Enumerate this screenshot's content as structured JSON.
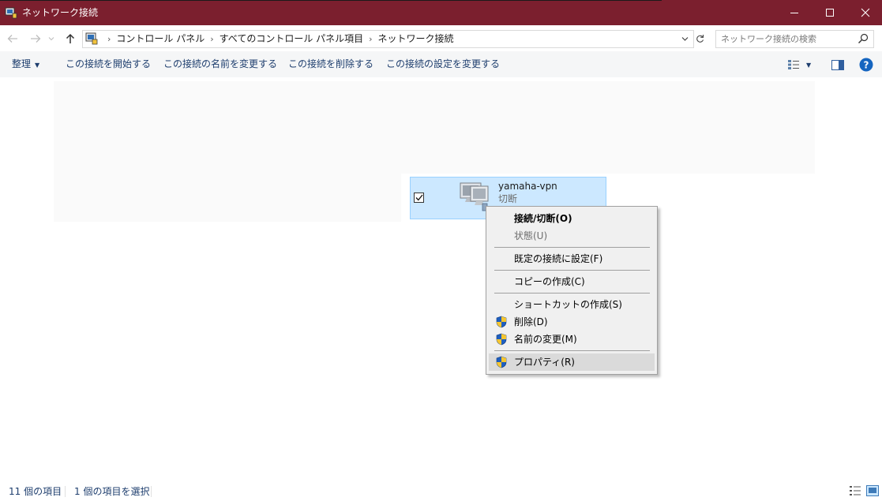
{
  "window": {
    "title": "ネットワーク接続",
    "accent_color": "#7b1f2e"
  },
  "address_bar": {
    "breadcrumbs": [
      "コントロール パネル",
      "すべてのコントロール パネル項目",
      "ネットワーク接続"
    ],
    "search_placeholder": "ネットワーク接続の検索"
  },
  "command_bar": {
    "organize": "整理",
    "commands": [
      "この接続を開始する",
      "この接続の名前を変更する",
      "この接続を削除する",
      "この接続の設定を変更する"
    ]
  },
  "connection_item": {
    "name": "yamaha-vpn",
    "status": "切断",
    "checked": true
  },
  "context_menu": {
    "items": [
      {
        "label": "接続/切断(O)",
        "bold": true,
        "disabled": false,
        "shield": false
      },
      {
        "label": "状態(U)",
        "bold": false,
        "disabled": true,
        "shield": false
      },
      {
        "label": "既定の接続に設定(F)",
        "bold": false,
        "disabled": false,
        "shield": false
      },
      {
        "label": "コピーの作成(C)",
        "bold": false,
        "disabled": false,
        "shield": false
      },
      {
        "label": "ショートカットの作成(S)",
        "bold": false,
        "disabled": false,
        "shield": false
      },
      {
        "label": "削除(D)",
        "bold": false,
        "disabled": false,
        "shield": true
      },
      {
        "label": "名前の変更(M)",
        "bold": false,
        "disabled": false,
        "shield": true
      },
      {
        "label": "プロパティ(R)",
        "bold": false,
        "disabled": false,
        "shield": true,
        "highlighted": true
      }
    ]
  },
  "status_bar": {
    "item_count": "11 個の項目",
    "selected_count": "1 個の項目を選択"
  },
  "icons": {
    "app": "network-connections-icon",
    "back": "back-arrow-icon",
    "forward": "forward-arrow-icon",
    "up": "up-arrow-icon",
    "search": "search-icon",
    "help": "help-icon",
    "shield": "uac-shield-icon"
  }
}
